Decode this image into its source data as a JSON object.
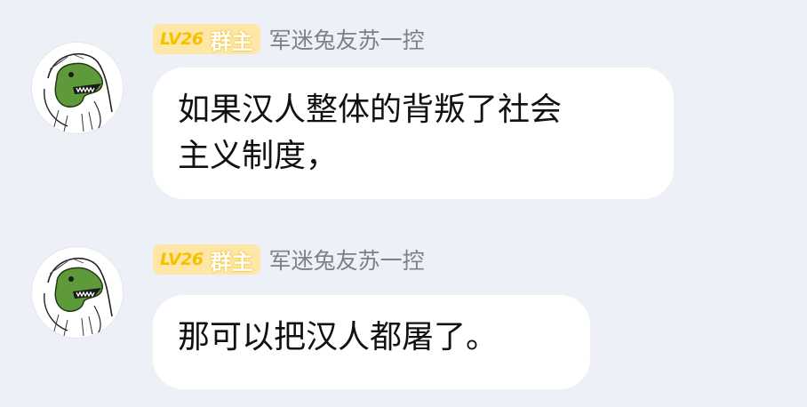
{
  "messages": [
    {
      "level_badge": "LV26",
      "role_badge": "群主",
      "sender_name": "军迷兔友苏一控",
      "text": "如果汉人整体的背叛了社会\n主义制度，"
    },
    {
      "level_badge": "LV26",
      "role_badge": "群主",
      "sender_name": "军迷兔友苏一控",
      "text": "那可以把汉人都屠了。"
    }
  ],
  "colors": {
    "background": "#eef0f7",
    "bubble": "#ffffff",
    "badge_bg": "#fde6a6",
    "badge_text": "#f6c000",
    "name_text": "#7c808c",
    "message_text": "#111111"
  },
  "icons": {
    "avatar": "cartoon-green-creature-avatar"
  }
}
